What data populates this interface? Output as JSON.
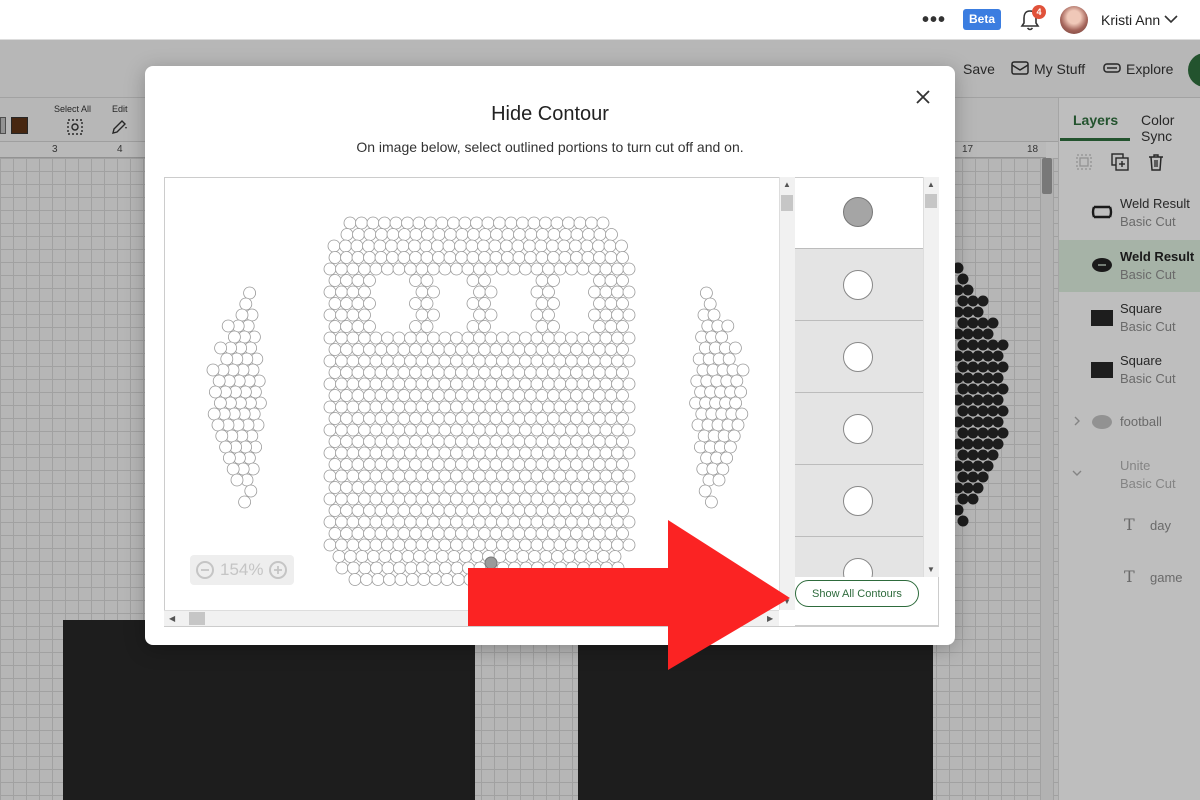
{
  "topbar": {
    "more_label": "•••",
    "beta_label": "Beta",
    "notification_count": "4",
    "user_name": "Kristi Ann"
  },
  "actions": {
    "save": "Save",
    "my_stuff": "My Stuff",
    "explore": "Explore"
  },
  "toolbar": {
    "select_all": "Select All",
    "edit": "Edit"
  },
  "ruler": [
    "3",
    "4",
    "17",
    "18"
  ],
  "panel": {
    "tabs": [
      "Layers",
      "Color Sync"
    ],
    "layers": [
      {
        "name": "Weld Result",
        "type": "Basic Cut"
      },
      {
        "name": "Weld Result",
        "type": "Basic Cut"
      },
      {
        "name": "Square",
        "type": "Basic Cut"
      },
      {
        "name": "Square",
        "type": "Basic Cut"
      }
    ],
    "group_football": "football",
    "group_unite": {
      "name": "Unite",
      "type": "Basic Cut"
    },
    "text_layers": [
      "day",
      "game"
    ]
  },
  "modal": {
    "title": "Hide Contour",
    "subtitle": "On image below, select outlined portions to turn cut off and on.",
    "zoom": "154%",
    "show_all_label": "Show All Contours"
  },
  "colors": {
    "accent": "#2e6b3c",
    "beta": "#3b7de0",
    "arrow": "#fb2323",
    "material": "#262626"
  }
}
